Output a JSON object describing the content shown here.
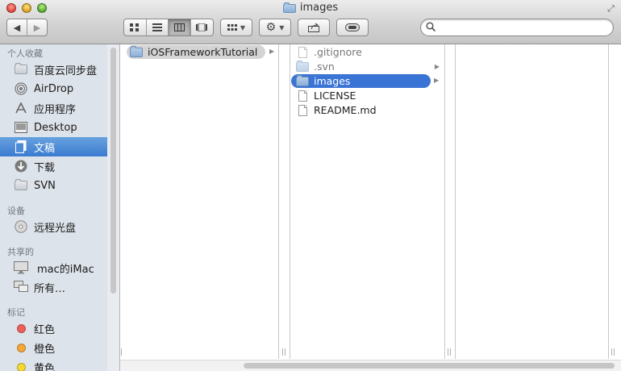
{
  "window": {
    "title": "images"
  },
  "toolbar": {
    "back_icon": "chevron-left-icon",
    "forward_icon": "chevron-right-icon",
    "view_modes": [
      "icon-view",
      "list-view",
      "column-view",
      "cover-flow-view"
    ],
    "active_view": "column-view",
    "arrange_icon": "grid-icon",
    "action_icon": "gear-icon",
    "share_icon": "share-icon",
    "tags_icon": "tag-icon",
    "search": {
      "value": "",
      "placeholder": ""
    }
  },
  "sidebar": {
    "sections": [
      {
        "title": "个人收藏",
        "items": [
          {
            "label": "百度云同步盘",
            "icon": "folder-icon"
          },
          {
            "label": "AirDrop",
            "icon": "airdrop-icon"
          },
          {
            "label": "应用程序",
            "icon": "applications-icon"
          },
          {
            "label": "Desktop",
            "icon": "desktop-icon"
          },
          {
            "label": "文稿",
            "icon": "documents-icon",
            "selected": true
          },
          {
            "label": "下载",
            "icon": "download-icon"
          },
          {
            "label": "SVN",
            "icon": "folder-icon"
          }
        ]
      },
      {
        "title": "设备",
        "items": [
          {
            "label": "远程光盘",
            "icon": "disc-icon"
          }
        ]
      },
      {
        "title": "共享的",
        "items": [
          {
            "label": "mac的iMac",
            "icon": "imac-icon"
          },
          {
            "label": "所有…",
            "icon": "network-icon"
          }
        ]
      },
      {
        "title": "标记",
        "items": [
          {
            "label": "红色",
            "color": "#f0605b"
          },
          {
            "label": "橙色",
            "color": "#f6a637"
          },
          {
            "label": "黄色",
            "color": "#f4d935"
          }
        ]
      }
    ]
  },
  "columns": [
    {
      "items": [
        {
          "name": "iOSFrameworkTutorial",
          "type": "folder",
          "has_children": true,
          "selected": "gray"
        }
      ]
    },
    {
      "items": [
        {
          "name": ".gitignore",
          "type": "file",
          "hidden": true
        },
        {
          "name": ".svn",
          "type": "folder",
          "hidden": true,
          "has_children": true
        },
        {
          "name": "images",
          "type": "folder",
          "has_children": true,
          "selected": "blue"
        },
        {
          "name": "LICENSE",
          "type": "file"
        },
        {
          "name": "README.md",
          "type": "file"
        }
      ]
    },
    {
      "items": []
    }
  ]
}
